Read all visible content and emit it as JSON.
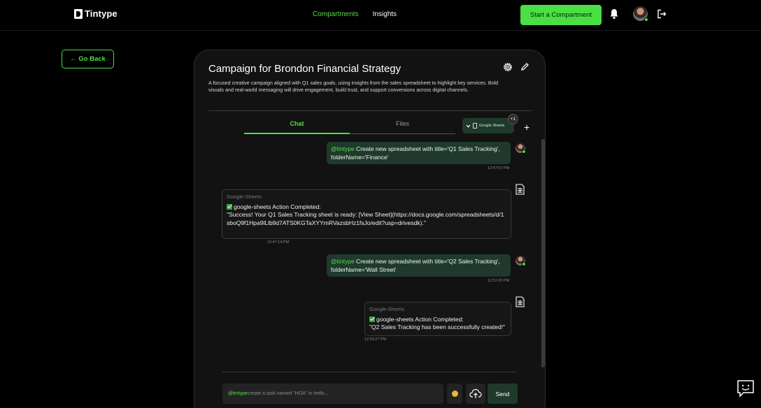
{
  "brand": {
    "name": "Tintype"
  },
  "nav": {
    "items": [
      {
        "label": "Compartments",
        "active": true
      },
      {
        "label": "Insights",
        "active": false
      }
    ]
  },
  "header": {
    "cta_label": "Start a Compartment",
    "accent": "#4ae043"
  },
  "goback": {
    "label": "← Go Back"
  },
  "compartment": {
    "title": "Campaign for Brondon Financial Strategy",
    "description": "A focused creative campaign aligned with Q1 sales goals, using insights from the sales spreadsheet to highlight key services. Bold visuals and real-world messaging will drive engagement, build trust, and support conversions across digital channels."
  },
  "tabs": {
    "chat": "Chat",
    "files": "Files"
  },
  "integration": {
    "label": "Google Sheets",
    "extra_count": "+1"
  },
  "messages": [
    {
      "type": "user",
      "mention": "@tintype",
      "text": " Create new spreadsheet with title='Q1 Sales Tracking', folderName='Finance'",
      "time": "12:47:07 PM"
    },
    {
      "type": "bot",
      "source": "Google-Sheets",
      "line1": "google-sheets Action Completed:",
      "line2": "\"Success! Your Q1 Sales Tracking sheet is ready: [View Sheet](https://docs.google.com/spreadsheets/d/1sboQ9f1Hpa9lLlb9d7ATS0KGTaXYYmRVazsbHz1fsJo/edit?usp=drivesdk).\"",
      "time": "12:47:14 PM"
    },
    {
      "type": "user",
      "mention": "@tintype",
      "text": " Create new spreadsheet with title='Q2 Sales Tracking', folderName='Wall Street'",
      "time": "12:51:20 PM"
    },
    {
      "type": "bot",
      "source": "Google-Sheets",
      "line1": "google-sheets Action Completed:",
      "line2": "\"Q2 Sales Tracking has been successfully created!\"",
      "time": "12:53:27 PM"
    }
  ],
  "composer": {
    "mention": "@tintype",
    "placeholder": " create a task named \"HOA\" in trello...",
    "send_label": "Send"
  }
}
